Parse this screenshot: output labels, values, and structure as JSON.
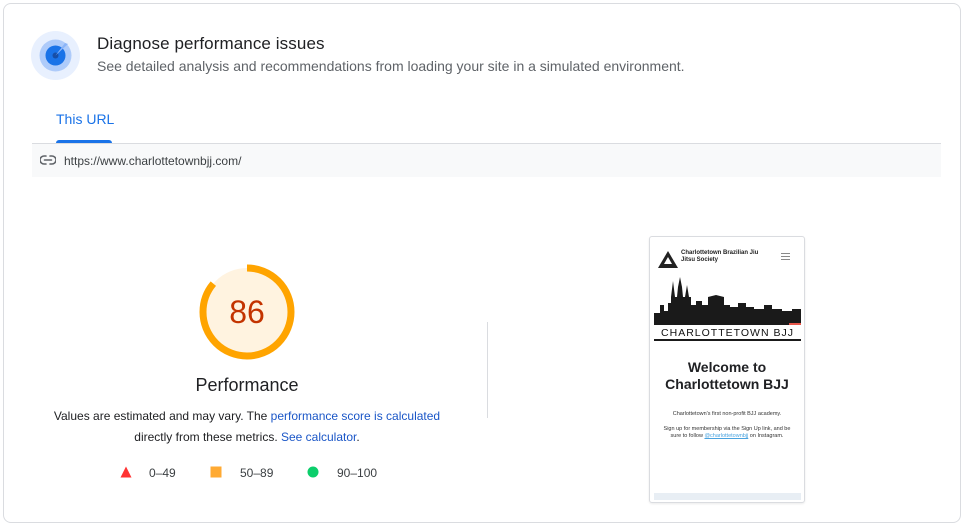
{
  "header": {
    "icon": "performance-gauge-icon",
    "title": "Diagnose performance issues",
    "subtitle": "See detailed analysis and recommendations from loading your site in a simulated environment."
  },
  "tabs": [
    {
      "label": "This URL",
      "active": true
    }
  ],
  "url_bar": {
    "icon": "link-icon",
    "url": "https://www.charlottetownbjj.com/"
  },
  "score": {
    "value": "86",
    "value_number": 86,
    "label": "Performance",
    "color": "#c33300",
    "ring_color": "#ffa400",
    "ring_bg": "#fff3e0"
  },
  "description": {
    "text1": "Values are estimated and may vary. The ",
    "link1": "performance score is calculated",
    "text2": "directly from these metrics. ",
    "link2": "See calculator",
    "text3": "."
  },
  "legend": [
    {
      "shape": "triangle",
      "color": "#ff3333",
      "range": "0–49"
    },
    {
      "shape": "square",
      "color": "#ffaa33",
      "range": "50–89"
    },
    {
      "shape": "circle",
      "color": "#0cce6b",
      "range": "90–100"
    }
  ],
  "screenshot": {
    "site_name": "Charlottetown Brazilian Jiu Jitsu Society",
    "banner_text": "CHARLOTTETOWN BJJ",
    "heading": "Welcome to Charlottetown BJJ",
    "paragraph1": "Charlottetown's first non-profit BJJ academy.",
    "paragraph2_pre": "Sign up for membership via the Sign Up link, and be sure to follow ",
    "paragraph2_link": "@charlottetownbjj",
    "paragraph2_post": " on Instagram."
  }
}
